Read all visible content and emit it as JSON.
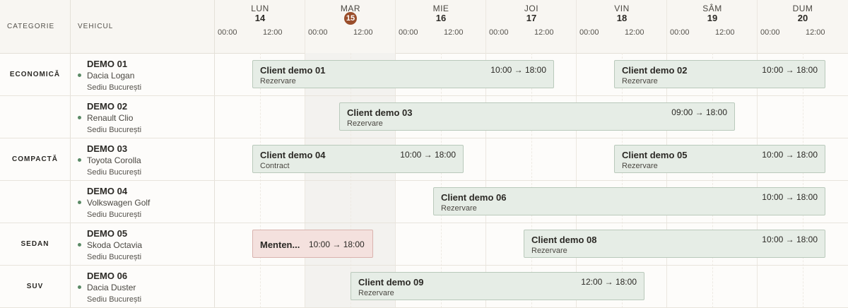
{
  "headers": {
    "category": "CATEGORIE",
    "vehicle": "VEHICUL"
  },
  "days": [
    {
      "name": "LUN",
      "num": "14",
      "today": false
    },
    {
      "name": "MAR",
      "num": "15",
      "today": true
    },
    {
      "name": "MIE",
      "num": "16",
      "today": false
    },
    {
      "name": "JOI",
      "num": "17",
      "today": false
    },
    {
      "name": "VIN",
      "num": "18",
      "today": false
    },
    {
      "name": "SÂM",
      "num": "19",
      "today": false
    },
    {
      "name": "DUM",
      "num": "20",
      "today": false
    }
  ],
  "hours": [
    "00:00",
    "12:00"
  ],
  "categories": [
    {
      "label": "ECONOMICĂ"
    },
    {
      "label": "COMPACTĂ"
    },
    {
      "label": "SEDAN"
    },
    {
      "label": "SUV"
    }
  ],
  "vehicles": [
    {
      "code": "DEMO 01",
      "model": "Dacia Logan",
      "location": "Sediu București"
    },
    {
      "code": "DEMO 02",
      "model": "Renault Clio",
      "location": "Sediu București"
    },
    {
      "code": "DEMO 03",
      "model": "Toyota Corolla",
      "location": "Sediu București"
    },
    {
      "code": "DEMO 04",
      "model": "Volkswagen Golf",
      "location": "Sediu București"
    },
    {
      "code": "DEMO 05",
      "model": "Skoda Octavia",
      "location": "Sediu București"
    },
    {
      "code": "DEMO 06",
      "model": "Dacia Duster",
      "location": "Sediu București"
    }
  ],
  "bookings": [
    {
      "row": 0,
      "client": "Client demo 01",
      "time": "10:00 → 18:00",
      "status": "Rezervare",
      "type": "reservation"
    },
    {
      "row": 0,
      "client": "Client demo 02",
      "time": "10:00 → 18:00",
      "status": "Rezervare",
      "type": "reservation"
    },
    {
      "row": 1,
      "client": "Client demo 03",
      "time": "09:00 → 18:00",
      "status": "Rezervare",
      "type": "reservation"
    },
    {
      "row": 2,
      "client": "Client demo 04",
      "time": "10:00 → 18:00",
      "status": "Contract",
      "type": "contract"
    },
    {
      "row": 2,
      "client": "Client demo 05",
      "time": "10:00 → 18:00",
      "status": "Rezervare",
      "type": "reservation"
    },
    {
      "row": 3,
      "client": "Client demo 06",
      "time": "10:00 → 18:00",
      "status": "Rezervare",
      "type": "reservation"
    },
    {
      "row": 4,
      "client": "Menten...",
      "time": "10:00 → 18:00",
      "status": "",
      "type": "maintenance"
    },
    {
      "row": 4,
      "client": "Client demo 08",
      "time": "10:00 → 18:00",
      "status": "Rezervare",
      "type": "reservation"
    },
    {
      "row": 5,
      "client": "Client demo 09",
      "time": "12:00 → 18:00",
      "status": "Rezervare",
      "type": "reservation"
    }
  ],
  "colors": {
    "today_badge": "#9a4e2b",
    "reservation_bg": "#e6ede6",
    "maintenance_bg": "#f4e1de",
    "vehicle_dot": "#5b8a66"
  }
}
